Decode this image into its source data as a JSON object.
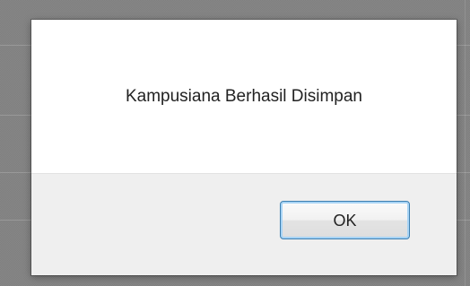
{
  "dialog": {
    "message": "Kampusiana Berhasil Disimpan",
    "ok_label": "OK"
  },
  "colors": {
    "overlay": "#7f7f7f",
    "dialog_body": "#ffffff",
    "dialog_footer": "#efefef",
    "button_border": "#3c7fb1",
    "button_focus_ring": "#a8d4f5"
  }
}
